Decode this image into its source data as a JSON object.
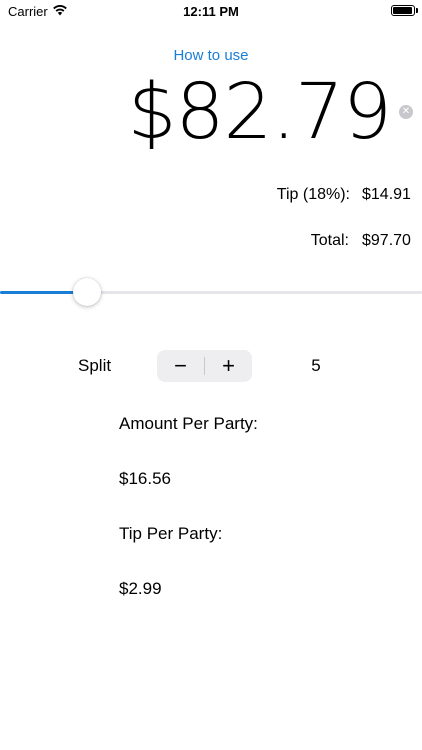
{
  "status_bar": {
    "carrier": "Carrier",
    "time": "12:11 PM",
    "battery_level": 0.95
  },
  "help_link": "How to use",
  "bill": {
    "amount": "$82.79",
    "clear_icon": "clear-circle-icon"
  },
  "tip": {
    "label": "Tip (18%):",
    "value": "$14.91",
    "percent": 18
  },
  "total": {
    "label": "Total:",
    "value": "$97.70"
  },
  "slider": {
    "fraction": 0.205,
    "accent_color": "#1a7ed6"
  },
  "split": {
    "label": "Split",
    "minus": "−",
    "plus": "+",
    "count": "5"
  },
  "per_party": {
    "amount_label": "Amount Per Party:",
    "amount_value": "$16.56",
    "tip_label": "Tip Per Party:",
    "tip_value": "$2.99"
  }
}
